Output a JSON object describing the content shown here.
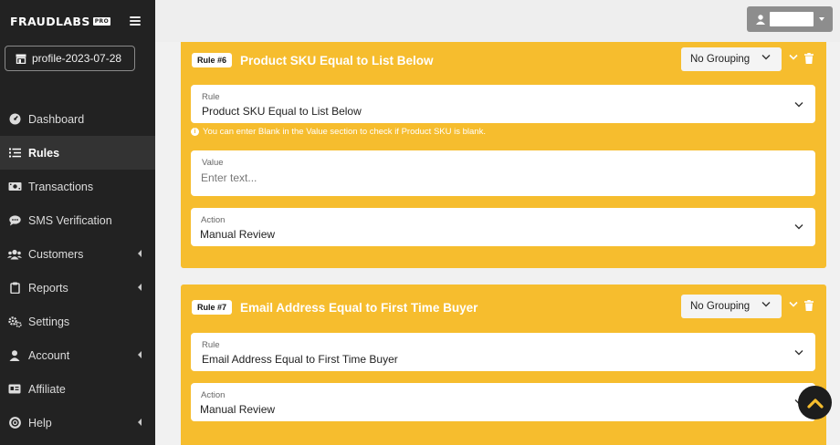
{
  "brand": {
    "name": "FRAUDLABS",
    "badge": "PRO"
  },
  "profile": {
    "label": "profile-2023-07-28"
  },
  "nav": {
    "items": [
      {
        "label": "Dashboard",
        "icon": "dashboard-icon"
      },
      {
        "label": "Rules",
        "icon": "rules-list-icon",
        "active": true
      },
      {
        "label": "Transactions",
        "icon": "transactions-icon"
      },
      {
        "label": "SMS Verification",
        "icon": "sms-icon"
      },
      {
        "label": "Customers",
        "icon": "customers-icon",
        "submenu": true
      },
      {
        "label": "Reports",
        "icon": "reports-icon",
        "submenu": true
      },
      {
        "label": "Settings",
        "icon": "settings-icon"
      },
      {
        "label": "Account",
        "icon": "account-icon",
        "submenu": true
      },
      {
        "label": "Affiliate",
        "icon": "affiliate-icon"
      },
      {
        "label": "Help",
        "icon": "help-icon",
        "submenu": true
      }
    ]
  },
  "rules": [
    {
      "badge": "Rule #6",
      "title": "Product SKU Equal to List Below",
      "grouping": "No Grouping",
      "rule_label": "Rule",
      "rule_value": "Product SKU Equal to List Below",
      "hint": "You can enter Blank in the Value section to check if Product SKU is blank.",
      "value_label": "Value",
      "value_placeholder": "Enter text...",
      "action_label": "Action",
      "action_value": "Manual Review"
    },
    {
      "badge": "Rule #7",
      "title": "Email Address Equal to First Time Buyer",
      "grouping": "No Grouping",
      "rule_label": "Rule",
      "rule_value": "Email Address Equal to First Time Buyer",
      "action_label": "Action",
      "action_value": "Manual Review"
    }
  ],
  "colors": {
    "sidebar": "#222222",
    "sidebar_active": "#333333",
    "card": "#f6bd2e",
    "accent_text": "#ffffff"
  }
}
